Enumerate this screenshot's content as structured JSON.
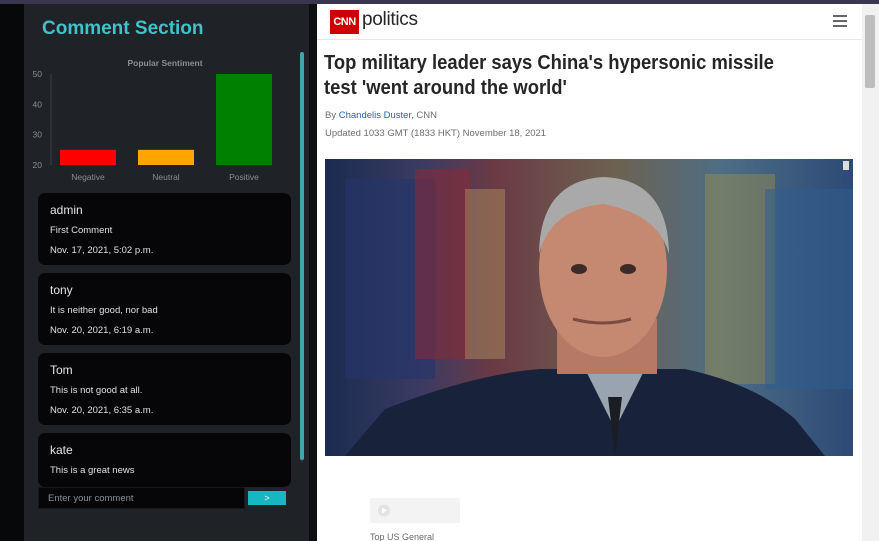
{
  "comments_panel": {
    "title": "Comment Section",
    "input_placeholder": "Enter your comment",
    "submit_label": ">",
    "comments": [
      {
        "author": "admin",
        "text": "First Comment",
        "date": "Nov. 17, 2021, 5:02 p.m."
      },
      {
        "author": "tony",
        "text": "It is neither good, nor bad",
        "date": "Nov. 20, 2021, 6:19 a.m."
      },
      {
        "author": "Tom",
        "text": "This is not good at all.",
        "date": "Nov. 20, 2021, 6:35 a.m."
      },
      {
        "author": "kate",
        "text": "This is a great news",
        "date": ""
      }
    ]
  },
  "chart_data": {
    "type": "bar",
    "title": "Popular Sentiment",
    "categories": [
      "Negative",
      "Neutral",
      "Positive"
    ],
    "values": [
      25,
      25,
      50
    ],
    "colors": [
      "#ff0000",
      "#ffa500",
      "#008000"
    ],
    "ylim": [
      20,
      50
    ],
    "yticks": [
      20,
      30,
      40,
      50
    ],
    "grid": false,
    "legend": "none"
  },
  "article": {
    "site_logo": "CNN",
    "section": "politics",
    "headline": "Top military leader says China's hypersonic missile test 'went around the world'",
    "byline_prefix": "By ",
    "author": "Chandelis Duster",
    "byline_suffix": ", CNN",
    "updated": "Updated 1033 GMT (1833 HKT) November 18, 2021",
    "caption": "Top US General",
    "icons": [
      "menu-icon",
      "play-icon"
    ]
  }
}
